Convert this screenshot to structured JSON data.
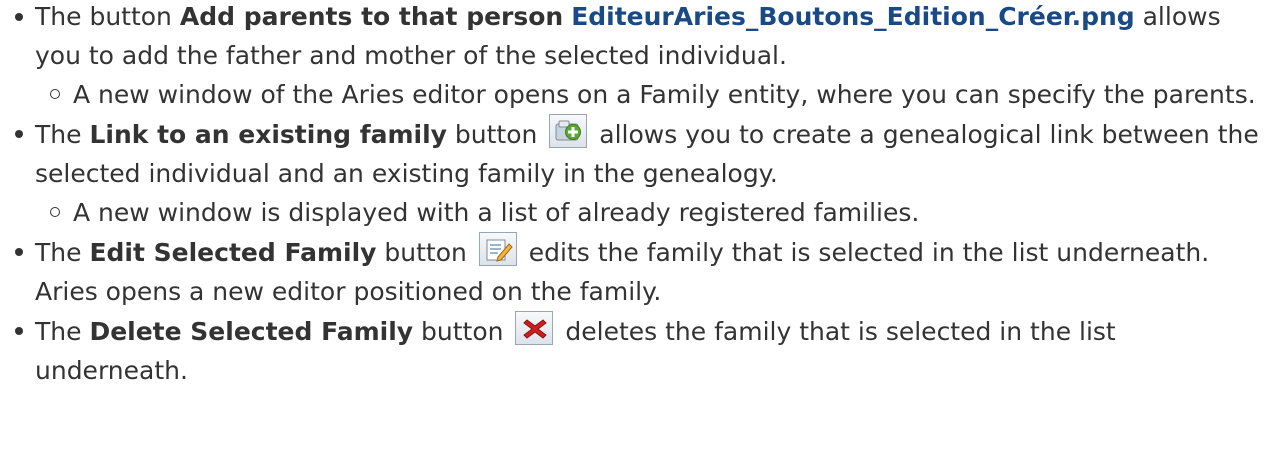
{
  "items": [
    {
      "prefix": "The button ",
      "bold": "Add parents to that person",
      "image_alt": "EditeurAries_Boutons_Edition_Créer.png",
      "suffix": "allows you to add the father and mother of the selected individual.",
      "sub": "A new window of the Aries editor opens on a Family entity, where you can specify the parents."
    },
    {
      "prefix": "The ",
      "bold": "Link to an existing family",
      "mid": " button ",
      "icon": "add-link-icon",
      "suffix": " allows you to create a genealogical link between the selected individual and an existing family in the genealogy.",
      "sub": "A new window is displayed with a list of already registered families."
    },
    {
      "prefix": "The ",
      "bold": "Edit Selected Family",
      "mid": " button ",
      "icon": "edit-family-icon",
      "suffix": " edits the family that is selected in the list underneath.  Aries opens a new editor positioned on the family."
    },
    {
      "prefix": "The ",
      "bold": "Delete Selected Family",
      "mid": " button ",
      "icon": "delete-icon",
      "suffix": " deletes the family that is selected in the list underneath."
    }
  ],
  "colors": {
    "text": "#333333",
    "image_alt": "#1a4a86",
    "delete_icon": "#cc1f1f",
    "add_icon": "#5aa830"
  }
}
